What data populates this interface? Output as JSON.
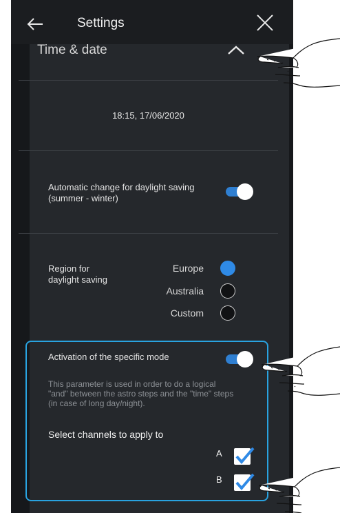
{
  "header": {
    "title": "Settings",
    "back_icon": "arrow-left-icon",
    "close_icon": "close-icon"
  },
  "section": {
    "title": "Time & date",
    "expanded": true
  },
  "datetime": {
    "value": "18:15, 17/06/2020"
  },
  "daylight": {
    "label_line1": "Automatic change for daylight saving",
    "label_line2": "(summer - winter)",
    "enabled": true
  },
  "region": {
    "label_line1": "Region for",
    "label_line2": "daylight saving",
    "options": [
      {
        "label": "Europe",
        "selected": true
      },
      {
        "label": "Australia",
        "selected": false
      },
      {
        "label": "Custom",
        "selected": false
      }
    ]
  },
  "specific_mode": {
    "label": "Activation of the specific mode",
    "enabled": true,
    "description_line1": "This parameter is used in order to do a logical",
    "description_line2": "\"and\" between the astro steps and the \"time\" steps",
    "description_line3": "(in case of long day/night).",
    "channels_title": "Select channels to apply to",
    "channels": [
      {
        "label": "A",
        "checked": true
      },
      {
        "label": "B",
        "checked": true
      }
    ]
  },
  "colors": {
    "accent_blue": "#2f8ae6",
    "highlight_border": "#29a3e0",
    "panel_bg": "#25282c",
    "device_bg": "#16181b"
  }
}
